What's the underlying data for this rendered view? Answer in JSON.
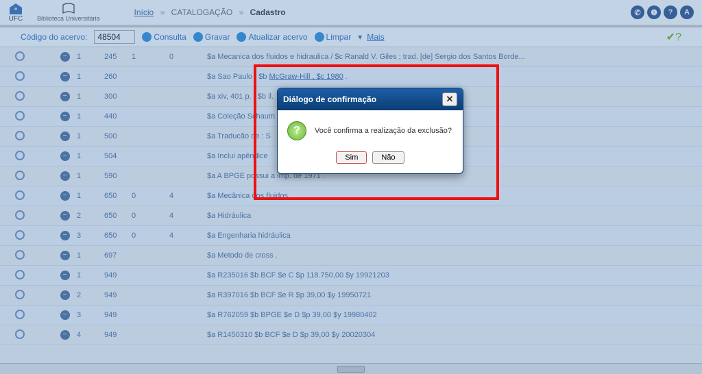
{
  "header": {
    "ufc_txt": "UFC",
    "bu_txt": "Biblioteca Universitária",
    "crumb_inicio": "Início",
    "crumb_catalog": "CATALOGAÇÃO",
    "crumb_cadastro": "Cadastro"
  },
  "toolbar": {
    "codigo_lbl": "Código do acervo:",
    "codigo_val": "48504",
    "consulta": "Consulta",
    "gravar": "Gravar",
    "atualizar": "Atualizar acervo",
    "limpar": "Limpar",
    "mais": "Mais"
  },
  "dialog": {
    "title": "Diálogo de confirmação",
    "msg": "Você confirma a realização da exclusão?",
    "sim": "Sim",
    "nao": "Não",
    "close": "✕"
  },
  "rows": [
    {
      "a": "1",
      "b": "245",
      "c": "1",
      "d": "0",
      "txt": "$a Mecanica dos fluidos e hidraulica / $c Ranald V. Giles ; trad. [de] Sergio dos Santos Borde..."
    },
    {
      "a": "1",
      "b": "260",
      "c": "",
      "d": "",
      "txt": "$a Sao Paulo : $b McGraw-Hill , $c 1980 ."
    },
    {
      "a": "1",
      "b": "300",
      "c": "",
      "d": "",
      "txt": "$a xiv, 401 p. : $b il."
    },
    {
      "a": "1",
      "b": "440",
      "c": "",
      "d": "",
      "txt": "$a Coleção Schaum"
    },
    {
      "a": "1",
      "b": "500",
      "c": "",
      "d": "",
      "txt": "$a Traducão de : S"
    },
    {
      "a": "1",
      "b": "504",
      "c": "",
      "d": "",
      "txt": "$a Inclui apêndice"
    },
    {
      "a": "1",
      "b": "590",
      "c": "",
      "d": "",
      "txt": "$a A BPGE possui a imp. de 1971 ."
    },
    {
      "a": "1",
      "b": "650",
      "c": "0",
      "d": "4",
      "txt": "$a Mecânica dos fluidos"
    },
    {
      "a": "2",
      "b": "650",
      "c": "0",
      "d": "4",
      "txt": "$a Hidráulica"
    },
    {
      "a": "3",
      "b": "650",
      "c": "0",
      "d": "4",
      "txt": "$a Engenharia hidráulica"
    },
    {
      "a": "1",
      "b": "697",
      "c": "",
      "d": "",
      "txt": "$a Metodo de cross ."
    },
    {
      "a": "1",
      "b": "949",
      "c": "",
      "d": "",
      "txt": "$a R235016 $b BCF $e C $p 118.750,00 $y 19921203"
    },
    {
      "a": "2",
      "b": "949",
      "c": "",
      "d": "",
      "txt": "$a R397016 $b BCF $e R $p 39,00 $y 19950721"
    },
    {
      "a": "3",
      "b": "949",
      "c": "",
      "d": "",
      "txt": "$a R762059 $b BPGE $e D $p 39,00 $y 19980402"
    },
    {
      "a": "4",
      "b": "949",
      "c": "",
      "d": "",
      "txt": "$a R1450310 $b BCF $e D $p 39,00 $y 20020304"
    }
  ]
}
